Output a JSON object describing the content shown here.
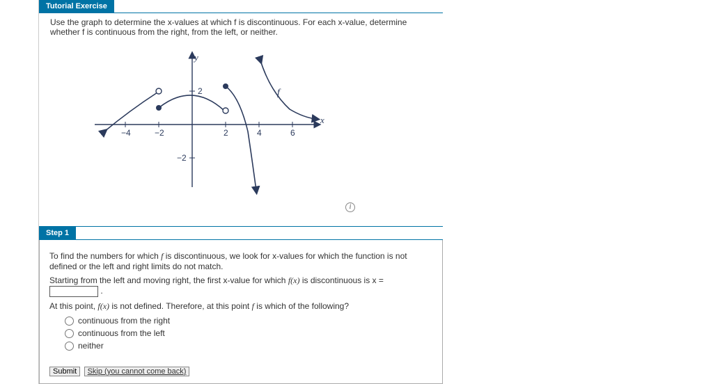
{
  "header": {
    "title": "Tutorial Exercise"
  },
  "instructions": "Use the graph to determine the x-values at which f is discontinuous. For each x-value, determine whether f is continuous from the right, from the left, or neither.",
  "chart_data": {
    "type": "line",
    "title": "",
    "xlabel": "x",
    "ylabel": "y",
    "x_ticks": [
      -4,
      -2,
      2,
      4,
      6
    ],
    "y_ticks": [
      -2,
      2
    ],
    "xlim": [
      -6,
      8
    ],
    "ylim": [
      -4,
      4
    ],
    "function_label": "f",
    "segments": [
      {
        "from_x": -6,
        "from_y": -0.5,
        "to_x": -2,
        "to_y": 2,
        "left_end": "arrow",
        "right_end": "open"
      },
      {
        "from_x": -2,
        "from_y": 1,
        "to_x": 2,
        "to_y": 0.9,
        "left_end": "closed",
        "right_end": "open",
        "note": "curved through (0,2) approx"
      },
      {
        "from_x": 2,
        "from_y": 2.3,
        "to_x": 4,
        "to_y": -4,
        "left_end": "closed",
        "right_end": "arrow",
        "note": "curves downward steeply"
      },
      {
        "from_x": 4,
        "from_y": 4,
        "to_x": 8,
        "to_y": 0.4,
        "left_end": "arrow",
        "right_end": "arrow",
        "note": "decreasing curve"
      }
    ],
    "discontinuities": [
      -2,
      2,
      4
    ]
  },
  "step1": {
    "title": "Step 1",
    "p1_a": "To find the numbers for which ",
    "p1_b": " is discontinuous, we look for x-values for which the function is not defined or the left and right limits do not match.",
    "p2_a": "Starting from the left and moving right, the first x-value for which ",
    "p2_b": " is discontinuous is x = ",
    "p2_c": ".",
    "p3_a": "At this point, ",
    "p3_b": " is not defined. Therefore, at this point ",
    "p3_c": " is which of the following?",
    "f_sym": "f",
    "fx_sym": "f(x)",
    "options": [
      "continuous from the right",
      "continuous from the left",
      "neither"
    ],
    "buttons": {
      "submit": "Submit",
      "skip": "Skip (you cannot come back)"
    }
  }
}
